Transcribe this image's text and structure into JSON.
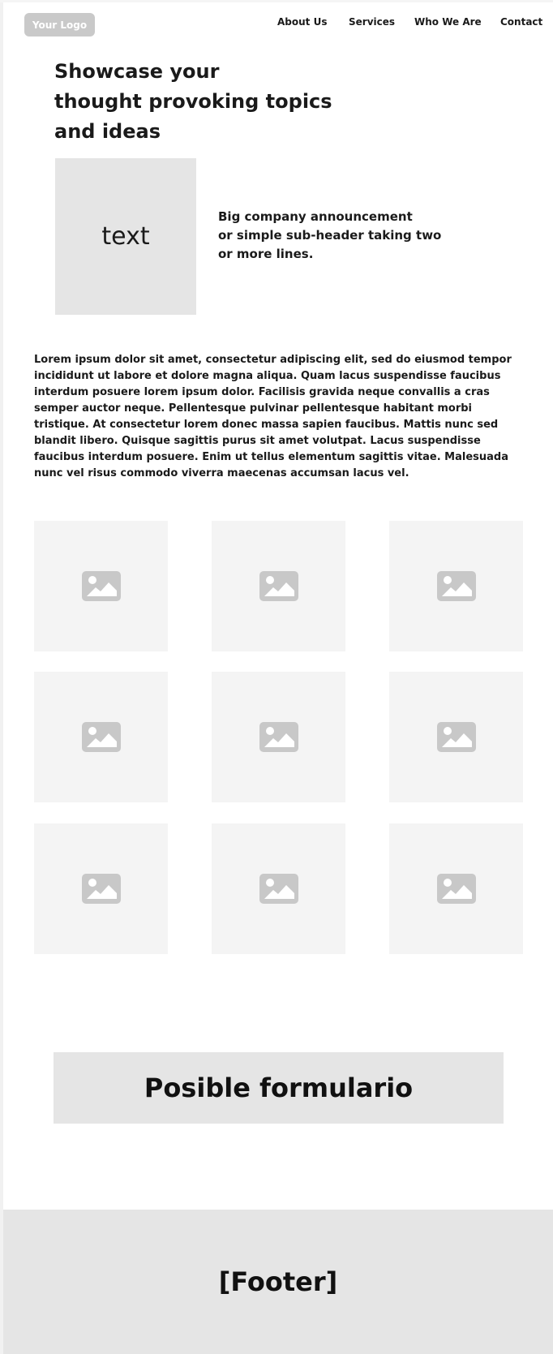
{
  "header": {
    "logo_text": "Your Logo",
    "nav": [
      "About Us",
      "Services",
      "Who We Are",
      "Contact"
    ]
  },
  "hero": {
    "title_lines": [
      "Showcase your",
      "thought provoking topics",
      "and ideas"
    ],
    "text_box_label": "text",
    "subheader_lines": [
      "Big company announcement",
      "or simple sub-header taking two",
      "or more lines."
    ]
  },
  "body": {
    "paragraph": "Lorem ipsum dolor sit amet, consectetur adipiscing elit, sed do eiusmod tempor incididunt ut labore et dolore magna aliqua. Quam lacus suspendisse faucibus interdum posuere lorem ipsum dolor. Facilisis gravida neque convallis a cras semper auctor neque. Pellentesque pulvinar pellentesque habitant morbi tristique. At consectetur lorem donec massa sapien faucibus. Mattis nunc sed blandit libero. Quisque sagittis purus sit amet volutpat. Lacus suspendisse faucibus interdum posuere. Enim ut tellus elementum sagittis vitae. Malesuada nunc vel risus commodo viverra maecenas accumsan lacus vel."
  },
  "gallery": {
    "items": [
      "image-icon",
      "image-icon",
      "image-icon",
      "image-icon",
      "image-icon",
      "image-icon",
      "image-icon",
      "image-icon",
      "image-icon"
    ]
  },
  "form": {
    "label": "Posible formulario"
  },
  "footer": {
    "label": "[Footer]"
  },
  "colors": {
    "placeholder_dark": "#e5e5e5",
    "placeholder_light": "#f4f4f4",
    "icon": "#c8c8c8",
    "logo": "#c9c9c9"
  }
}
